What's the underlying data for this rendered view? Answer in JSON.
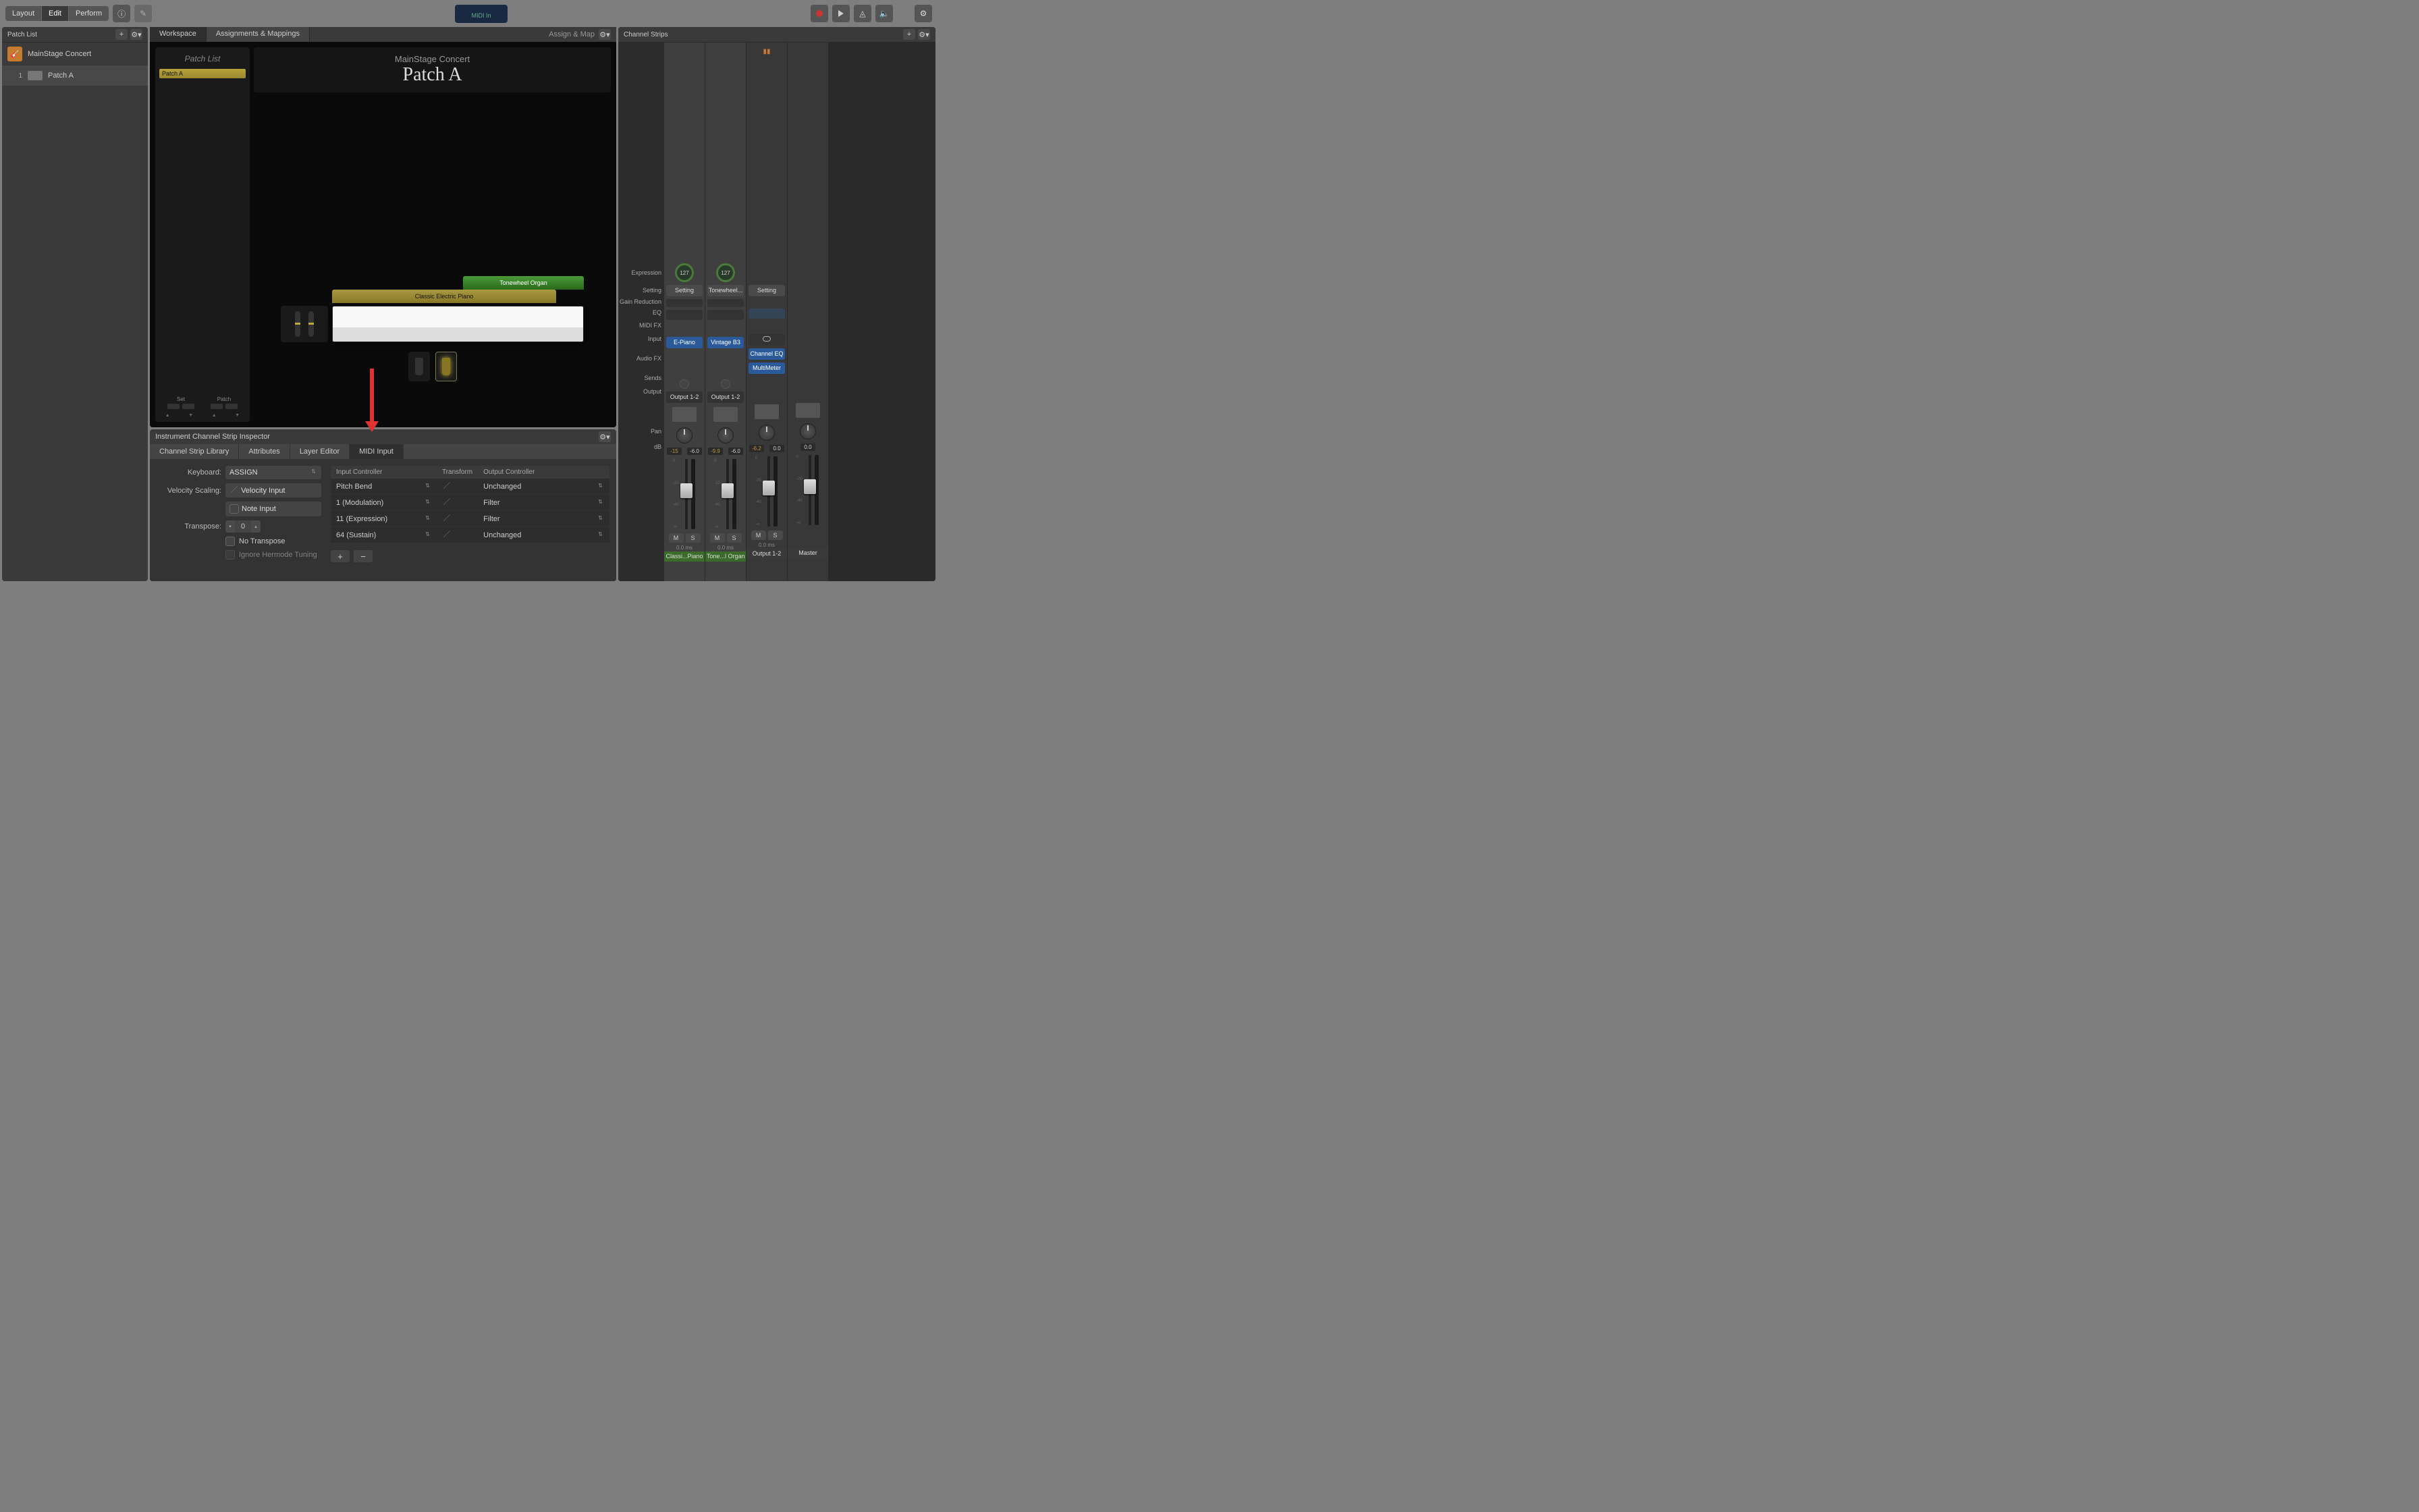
{
  "toolbar": {
    "modes": [
      "Layout",
      "Edit",
      "Perform"
    ],
    "active_mode": "Edit",
    "midi_display": "MIDI In"
  },
  "patch_list": {
    "title": "Patch List",
    "concert_name": "MainStage Concert",
    "patches": [
      {
        "num": "1",
        "name": "Patch A"
      }
    ]
  },
  "center_tabs": {
    "tabs": [
      "Workspace",
      "Assignments & Mappings"
    ],
    "active": "Workspace",
    "assign_map": "Assign & Map"
  },
  "workspace": {
    "patch_list_title": "Patch List",
    "selected_patch": "Patch A",
    "concert_name": "MainStage Concert",
    "patch_name": "Patch A",
    "layers": {
      "organ": "Tonewheel Organ",
      "piano": "Classic Electric Piano"
    },
    "set_label": "Set",
    "patch_label": "Patch"
  },
  "inspector": {
    "title": "Instrument Channel Strip Inspector",
    "tabs": [
      "Channel Strip Library",
      "Attributes",
      "Layer Editor",
      "MIDI Input"
    ],
    "active_tab": "MIDI Input",
    "keyboard_label": "Keyboard:",
    "keyboard_value": "ASSIGN",
    "velocity_label": "Velocity Scaling:",
    "velocity_value": "Velocity Input",
    "note_input": "Note Input",
    "transpose_label": "Transpose:",
    "transpose_value": "0",
    "no_transpose": "No Transpose",
    "hermode": "Ignore Hermode Tuning",
    "table": {
      "headers": [
        "Input Controller",
        "Transform",
        "Output Controller"
      ],
      "rows": [
        {
          "input": "Pitch Bend",
          "output": "Unchanged"
        },
        {
          "input": "1 (Modulation)",
          "output": "Filter"
        },
        {
          "input": "11 (Expression)",
          "output": "Filter"
        },
        {
          "input": "64 (Sustain)",
          "output": "Unchanged"
        }
      ]
    }
  },
  "channel_strips": {
    "title": "Channel Strips",
    "row_labels": [
      "Expression",
      "Setting",
      "Gain Reduction",
      "EQ",
      "MIDI FX",
      "Input",
      "Audio FX",
      "Sends",
      "Output",
      "Pan",
      "dB"
    ],
    "strips": [
      {
        "expr": "127",
        "setting": "Setting",
        "input": "E-Piano",
        "input_color": "blue",
        "audio_fx": [],
        "output": "Output 1-2",
        "db": [
          "-15",
          "-6.0"
        ],
        "ms": true,
        "latency": "0.0 ms",
        "name": "Classi...Piano",
        "name_color": "green"
      },
      {
        "expr": "127",
        "setting": "Tonewheel...",
        "input": "Vintage B3",
        "input_color": "blue",
        "audio_fx": [],
        "output": "Output 1-2",
        "db": [
          "-9.9",
          "-6.0"
        ],
        "ms": true,
        "latency": "0.0 ms",
        "name": "Tone...l Organ",
        "name_color": "green"
      },
      {
        "expr": "",
        "setting": "Setting",
        "input": "link",
        "audio_fx": [
          "Channel EQ",
          "MultiMeter"
        ],
        "output": "",
        "db": [
          "-6.2",
          "0.0"
        ],
        "ms": true,
        "latency": "0.0 ms",
        "name": "Output 1-2",
        "name_color": "grey"
      },
      {
        "expr": "",
        "setting": "",
        "input": "",
        "audio_fx": [],
        "output": "",
        "db": [
          "0.0"
        ],
        "ms": false,
        "latency": "",
        "name": "Master",
        "name_color": "grey"
      }
    ]
  }
}
